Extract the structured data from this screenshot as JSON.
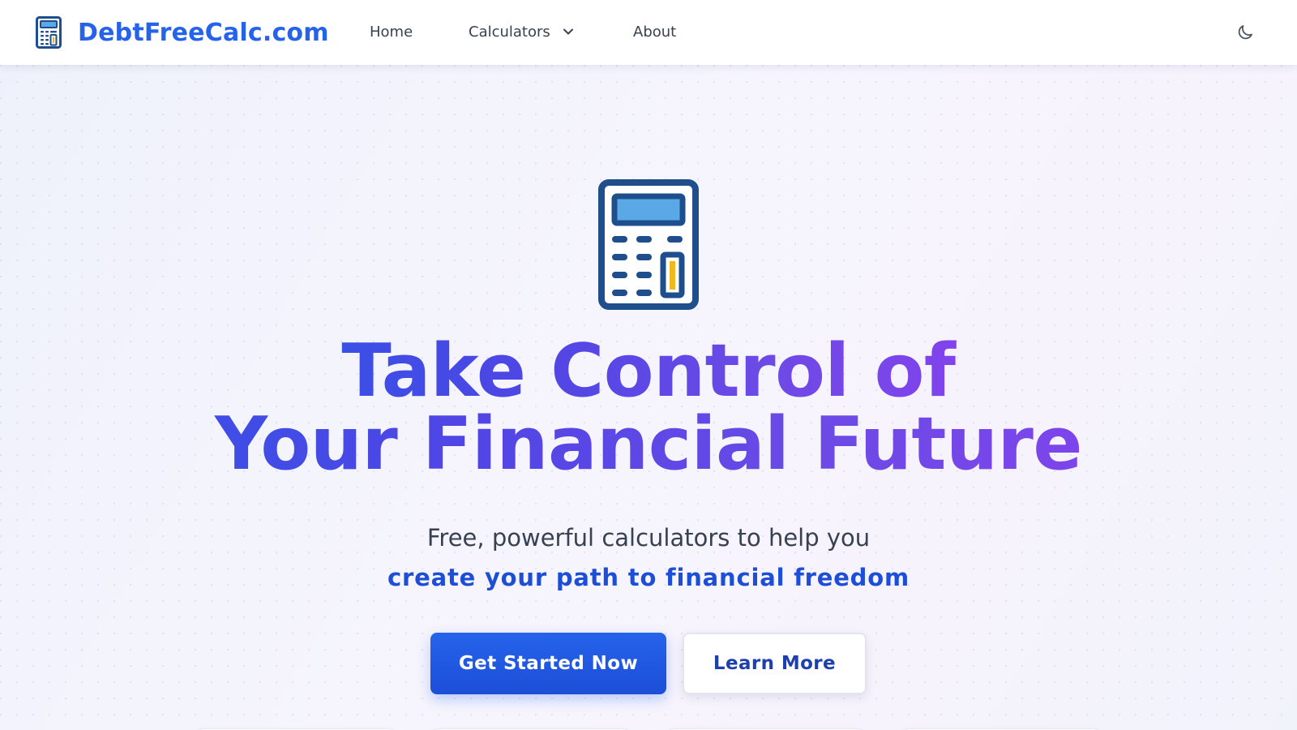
{
  "navbar": {
    "brand_name": "DebtFreeCalc.com",
    "brand_icon": "calculator-icon",
    "links": {
      "home": "Home",
      "calculators": "Calculators",
      "about": "About"
    },
    "theme_toggle_icon": "moon-icon"
  },
  "hero": {
    "icon": "calculator-icon",
    "title_line1": "Take Control of",
    "title_line2": "Your Financial Future",
    "subtitle": "Free, powerful calculators to help you",
    "subtitle_emphasis": "create your path to financial freedom",
    "primary_button": "Get Started Now",
    "secondary_button": "Learn More"
  },
  "colors": {
    "brand_blue": "#2563eb",
    "gradient_start": "#2f54e6",
    "gradient_end": "#8b3ff0",
    "calculator_outline": "#1e4e8c",
    "calculator_screen": "#5aa9e6",
    "calculator_accent": "#f2b91e"
  }
}
